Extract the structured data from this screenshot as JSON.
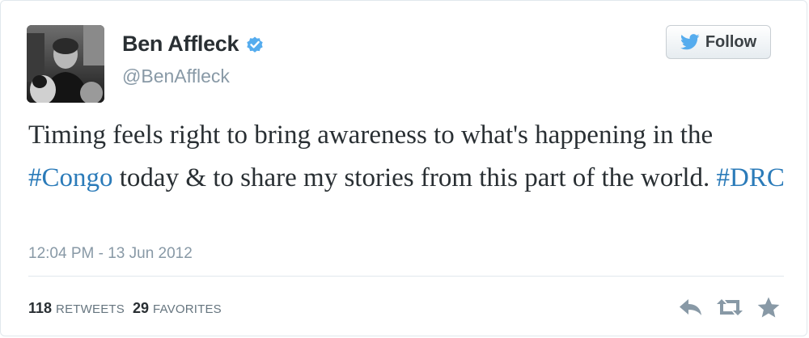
{
  "user": {
    "display_name": "Ben Affleck",
    "handle": "@BenAffleck",
    "verified": true
  },
  "follow_button": {
    "label": "Follow"
  },
  "tweet": {
    "segments": [
      {
        "text": "Timing feels right to bring awareness to what's happening in the ",
        "type": "text"
      },
      {
        "text": "#Congo",
        "type": "hashtag"
      },
      {
        "text": " today & to share my stories from this part of the world. ",
        "type": "text"
      },
      {
        "text": "#DRC",
        "type": "hashtag"
      }
    ],
    "timestamp": "12:04 PM - 13 Jun 2012"
  },
  "stats": {
    "retweets_count": "118",
    "retweets_label": "RETWEETS",
    "favorites_count": "29",
    "favorites_label": "FAVORITES"
  },
  "icons": {
    "bird": "twitter-bird-icon",
    "verified": "verified-badge-icon",
    "reply": "reply-icon",
    "retweet": "retweet-icon",
    "favorite": "star-icon"
  },
  "colors": {
    "hashtag": "#2b7bb9",
    "verified": "#55acee",
    "bird": "#55acee",
    "muted": "#8899a6",
    "action_icon": "#8899a6"
  }
}
